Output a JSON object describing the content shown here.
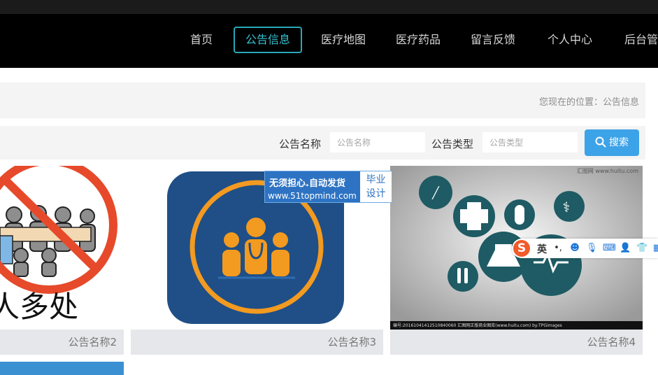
{
  "nav": {
    "items": [
      "首页",
      "公告信息",
      "医疗地图",
      "医疗药品",
      "留言反馈",
      "个人中心",
      "后台管"
    ],
    "active_index": 1
  },
  "breadcrumb": {
    "text": "您现在的位置：公告信息"
  },
  "search": {
    "name_label": "公告名称",
    "name_placeholder": "公告名称",
    "type_label": "公告类型",
    "type_placeholder": "公告类型",
    "button_label": "搜索"
  },
  "cards": [
    {
      "caption": "公告名称2",
      "image_text": "人多处"
    },
    {
      "caption": "公告名称3"
    },
    {
      "caption": "公告名称4",
      "image_top_text": "汇图网 www.huitu.com",
      "image_bottom_text": "编号:20161041412510840060  汇图网正版商业图库(www.huitu.com) by:TPGimages"
    }
  ],
  "watermark": {
    "line1": "无须担心.自动发货",
    "line2": "www.51topmind.com",
    "box_line1": "毕业",
    "box_line2": "设计"
  },
  "ime_toolbar": {
    "logo": "S",
    "language": "英",
    "icons": [
      "punctuation-icon",
      "emoji-icon",
      "microphone-icon",
      "keyboard-icon",
      "user-icon",
      "skin-icon",
      "toolbox-icon"
    ]
  },
  "colors": {
    "nav_active": "#34c1d0",
    "search_button": "#3da3e8",
    "navbar_bg": "#000000"
  }
}
